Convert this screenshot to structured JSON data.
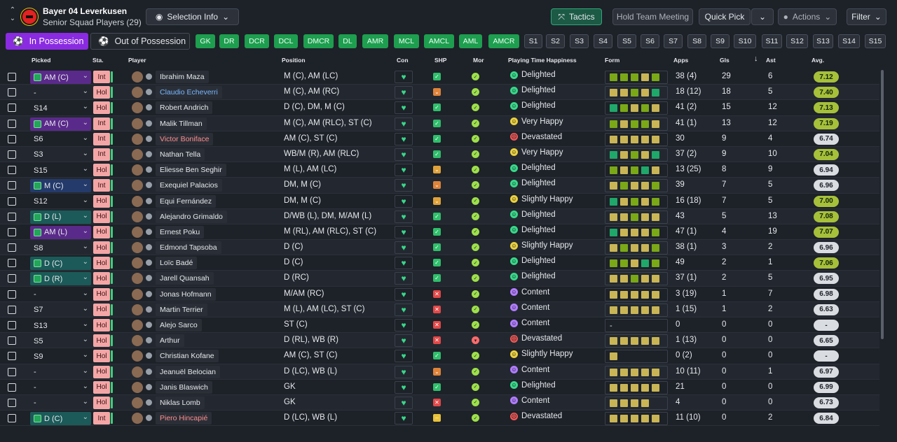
{
  "header": {
    "club": "Bayer 04 Leverkusen",
    "subtitle": "Senior Squad Players (29)",
    "selection_info": "Selection Info",
    "tactics": "Tactics",
    "hold_meeting": "Hold Team Meeting",
    "quick_pick": "Quick Pick",
    "actions": "Actions",
    "filter": "Filter"
  },
  "phase": {
    "in": "In Possession",
    "out": "Out of Possession"
  },
  "positions": [
    "GK",
    "DR",
    "DCR",
    "DCL",
    "DMCR",
    "DL",
    "AMR",
    "MCL",
    "AMCL",
    "AML",
    "AMCR"
  ],
  "sets": [
    "S1",
    "S2",
    "S3",
    "S4",
    "S5",
    "S6",
    "S7",
    "S8",
    "S9",
    "S10",
    "S11",
    "S12",
    "S13",
    "S14",
    "S15"
  ],
  "columns": {
    "picked": "Picked",
    "sta": "Sta.",
    "player": "Player",
    "position": "Position",
    "con": "Con",
    "shp": "SHP",
    "mor": "Mor",
    "pth": "Playing Time Happiness",
    "form": "Form",
    "apps": "Apps",
    "gls": "Gls",
    "ast": "Ast",
    "avg": "Avg."
  },
  "players": [
    {
      "picked": "AM (C)",
      "pk": "purple",
      "sta": "Int",
      "name": "Ibrahim Maza",
      "nc": "",
      "position": "M (C), AM (LC)",
      "shp": "ok",
      "mor": "ok",
      "happy": "Delighted",
      "hc": "#38d88a",
      "form": [
        "#7aa817",
        "#7aa817",
        "#7aa817",
        "#c9b555",
        "#7aa817"
      ],
      "apps": "38 (4)",
      "gls": "29",
      "ast": "6",
      "avg": "7.12",
      "ac": "hi"
    },
    {
      "picked": "-",
      "pk": "plain",
      "sta": "Hol",
      "name": "Claudio Echeverri",
      "nc": "blue",
      "position": "M (C), AM (RC)",
      "shp": "mid",
      "mor": "ok",
      "happy": "Delighted",
      "hc": "#38d88a",
      "form": [
        "#c9b555",
        "#c9b555",
        "#7aa817",
        "#c9b555",
        "#1fa86a"
      ],
      "apps": "18 (12)",
      "gls": "18",
      "ast": "5",
      "avg": "7.40",
      "ac": "hi"
    },
    {
      "picked": "S14",
      "pk": "plain",
      "sta": "Hol",
      "name": "Robert Andrich",
      "nc": "",
      "position": "D (C), DM, M (C)",
      "shp": "ok",
      "mor": "ok",
      "happy": "Delighted",
      "hc": "#38d88a",
      "form": [
        "#1fa86a",
        "#7aa817",
        "#c9b555",
        "#7aa817",
        "#c9b555"
      ],
      "apps": "41 (2)",
      "gls": "15",
      "ast": "12",
      "avg": "7.13",
      "ac": "hi"
    },
    {
      "picked": "AM (C)",
      "pk": "purple",
      "sta": "Int",
      "name": "Malik Tillman",
      "nc": "",
      "position": "M (C), AM (RLC), ST (C)",
      "shp": "ok",
      "mor": "ok",
      "happy": "Very Happy",
      "hc": "#e9d040",
      "form": [
        "#7aa817",
        "#c9b555",
        "#7aa817",
        "#7aa817",
        "#c9b555"
      ],
      "apps": "41 (1)",
      "gls": "13",
      "ast": "12",
      "avg": "7.19",
      "ac": "hi"
    },
    {
      "picked": "S6",
      "pk": "plain",
      "sta": "Int",
      "name": "Victor Boniface",
      "nc": "red",
      "position": "AM (C), ST (C)",
      "shp": "ok",
      "mor": "ok",
      "happy": "Devastated",
      "hc": "#f05a5a",
      "form": [
        "#c9b555",
        "#c9b555",
        "#c9b555",
        "#c9b555",
        "#c9b555"
      ],
      "apps": "30",
      "gls": "9",
      "ast": "4",
      "avg": "6.74",
      "ac": "md"
    },
    {
      "picked": "S3",
      "pk": "plain",
      "sta": "Int",
      "name": "Nathan Tella",
      "nc": "",
      "position": "WB/M (R), AM (RLC)",
      "shp": "ok",
      "mor": "ok",
      "happy": "Very Happy",
      "hc": "#e9d040",
      "form": [
        "#1fa86a",
        "#c9b555",
        "#7aa817",
        "#c9b555",
        "#1fa86a"
      ],
      "apps": "37 (2)",
      "gls": "9",
      "ast": "10",
      "avg": "7.04",
      "ac": "hi"
    },
    {
      "picked": "S15",
      "pk": "plain",
      "sta": "Hol",
      "name": "Eliesse Ben Seghir",
      "nc": "",
      "position": "M (L), AM (LC)",
      "shp": "mid2",
      "mor": "ok",
      "happy": "Delighted",
      "hc": "#38d88a",
      "form": [
        "#7aa817",
        "#c9b555",
        "#7aa817",
        "#1fa86a",
        "#c9b555"
      ],
      "apps": "13 (25)",
      "gls": "8",
      "ast": "9",
      "avg": "6.94",
      "ac": "md"
    },
    {
      "picked": "M (C)",
      "pk": "navy",
      "sta": "Int",
      "name": "Exequiel Palacios",
      "nc": "",
      "position": "DM, M (C)",
      "shp": "mid",
      "mor": "ok",
      "happy": "Delighted",
      "hc": "#38d88a",
      "form": [
        "#c9b555",
        "#7aa817",
        "#c9b555",
        "#c9b555",
        "#7aa817"
      ],
      "apps": "39",
      "gls": "7",
      "ast": "5",
      "avg": "6.96",
      "ac": "md"
    },
    {
      "picked": "S12",
      "pk": "plain",
      "sta": "Hol",
      "name": "Equi Fernández",
      "nc": "",
      "position": "DM, M (C)",
      "shp": "mid2",
      "mor": "ok",
      "happy": "Slightly Happy",
      "hc": "#e9d040",
      "form": [
        "#1fa86a",
        "#c9b555",
        "#7aa817",
        "#c9b555",
        "#7aa817"
      ],
      "apps": "16 (18)",
      "gls": "7",
      "ast": "5",
      "avg": "7.00",
      "ac": "hi"
    },
    {
      "picked": "D (L)",
      "pk": "teal",
      "sta": "Hol",
      "name": "Alejandro Grimaldo",
      "nc": "",
      "position": "D/WB (L), DM, M/AM (L)",
      "shp": "ok",
      "mor": "ok",
      "happy": "Delighted",
      "hc": "#38d88a",
      "form": [
        "#c9b555",
        "#c9b555",
        "#7aa817",
        "#c9b555",
        "#c9b555"
      ],
      "apps": "43",
      "gls": "5",
      "ast": "13",
      "avg": "7.08",
      "ac": "hi"
    },
    {
      "picked": "AM (L)",
      "pk": "purple",
      "sta": "Hol",
      "name": "Ernest Poku",
      "nc": "",
      "position": "M (RL), AM (RLC), ST (C)",
      "shp": "ok",
      "mor": "ok",
      "happy": "Delighted",
      "hc": "#38d88a",
      "form": [
        "#1fa86a",
        "#c9b555",
        "#c9b555",
        "#c9b555",
        "#7aa817"
      ],
      "apps": "47 (1)",
      "gls": "4",
      "ast": "19",
      "avg": "7.07",
      "ac": "hi"
    },
    {
      "picked": "S8",
      "pk": "plain",
      "sta": "Hol",
      "name": "Edmond Tapsoba",
      "nc": "",
      "position": "D (C)",
      "shp": "ok",
      "mor": "ok",
      "happy": "Slightly Happy",
      "hc": "#e9d040",
      "form": [
        "#c9b555",
        "#7aa817",
        "#c9b555",
        "#c9b555",
        "#7aa817"
      ],
      "apps": "38 (1)",
      "gls": "3",
      "ast": "2",
      "avg": "6.96",
      "ac": "md"
    },
    {
      "picked": "D (C)",
      "pk": "teal",
      "sta": "Hol",
      "name": "Loïc Badé",
      "nc": "",
      "position": "D (C)",
      "shp": "ok",
      "mor": "ok",
      "happy": "Delighted",
      "hc": "#38d88a",
      "form": [
        "#7aa817",
        "#7aa817",
        "#c9b555",
        "#1fa86a",
        "#7aa817"
      ],
      "apps": "49",
      "gls": "2",
      "ast": "1",
      "avg": "7.06",
      "ac": "hi"
    },
    {
      "picked": "D (R)",
      "pk": "teal",
      "sta": "Hol",
      "name": "Jarell Quansah",
      "nc": "",
      "position": "D (RC)",
      "shp": "ok",
      "mor": "ok",
      "happy": "Delighted",
      "hc": "#38d88a",
      "form": [
        "#c9b555",
        "#c9b555",
        "#7aa817",
        "#c9b555",
        "#c9b555"
      ],
      "apps": "37 (1)",
      "gls": "2",
      "ast": "5",
      "avg": "6.95",
      "ac": "md"
    },
    {
      "picked": "-",
      "pk": "plain",
      "sta": "Hol",
      "name": "Jonas Hofmann",
      "nc": "",
      "position": "M/AM (RC)",
      "shp": "bad",
      "mor": "ok",
      "happy": "Content",
      "hc": "#b07cff",
      "form": [
        "#c9b555",
        "#c9b555",
        "#c9b555",
        "#c9b555",
        "#c9b555"
      ],
      "apps": "3 (19)",
      "gls": "1",
      "ast": "7",
      "avg": "6.98",
      "ac": "md"
    },
    {
      "picked": "S7",
      "pk": "plain",
      "sta": "Hol",
      "name": "Martin Terrier",
      "nc": "",
      "position": "M (L), AM (LC), ST (C)",
      "shp": "bad",
      "mor": "ok",
      "happy": "Content",
      "hc": "#b07cff",
      "form": [
        "#c9b555",
        "#c9b555",
        "#c9b555",
        "#c9b555",
        "#c9b555"
      ],
      "apps": "1 (15)",
      "gls": "1",
      "ast": "2",
      "avg": "6.63",
      "ac": "md"
    },
    {
      "picked": "S13",
      "pk": "plain",
      "sta": "Hol",
      "name": "Alejo Sarco",
      "nc": "",
      "position": "ST (C)",
      "shp": "bad",
      "mor": "ok",
      "happy": "Content",
      "hc": "#b07cff",
      "form": [],
      "formtext": "-",
      "apps": "0",
      "gls": "0",
      "ast": "0",
      "avg": "-",
      "ac": "md"
    },
    {
      "picked": "S5",
      "pk": "plain",
      "sta": "Hol",
      "name": "Arthur",
      "nc": "",
      "position": "D (RL), WB (R)",
      "shp": "bad",
      "mor": "bad",
      "happy": "Devastated",
      "hc": "#f05a5a",
      "form": [
        "#c9b555",
        "#c9b555",
        "#c9b555",
        "#c9b555",
        "#c9b555"
      ],
      "apps": "1 (13)",
      "gls": "0",
      "ast": "0",
      "avg": "6.65",
      "ac": "md"
    },
    {
      "picked": "S9",
      "pk": "plain",
      "sta": "Hol",
      "name": "Christian Kofane",
      "nc": "",
      "position": "AM (C), ST (C)",
      "shp": "ok",
      "mor": "ok",
      "happy": "Slightly Happy",
      "hc": "#e9d040",
      "form": [
        "#c9b555"
      ],
      "apps": "0 (2)",
      "gls": "0",
      "ast": "0",
      "avg": "-",
      "ac": "md"
    },
    {
      "picked": "-",
      "pk": "plain",
      "sta": "Hol",
      "name": "Jeanuël Belocian",
      "nc": "",
      "position": "D (LC), WB (L)",
      "shp": "mid",
      "mor": "ok",
      "happy": "Content",
      "hc": "#b07cff",
      "form": [
        "#c9b555",
        "#c9b555",
        "#c9b555",
        "#c9b555",
        "#c9b555"
      ],
      "apps": "10 (11)",
      "gls": "0",
      "ast": "1",
      "avg": "6.97",
      "ac": "md"
    },
    {
      "picked": "-",
      "pk": "plain",
      "sta": "Hol",
      "name": "Janis Blaswich",
      "nc": "",
      "position": "GK",
      "shp": "ok",
      "mor": "ok",
      "happy": "Delighted",
      "hc": "#38d88a",
      "form": [
        "#c9b555",
        "#c9b555",
        "#c9b555",
        "#c9b555",
        "#c9b555"
      ],
      "apps": "21",
      "gls": "0",
      "ast": "0",
      "avg": "6.99",
      "ac": "md"
    },
    {
      "picked": "-",
      "pk": "plain",
      "sta": "Hol",
      "name": "Niklas Lomb",
      "nc": "",
      "position": "GK",
      "shp": "bad",
      "mor": "ok",
      "happy": "Content",
      "hc": "#b07cff",
      "form": [
        "#c9b555",
        "#c9b555",
        "#c9b555",
        "#c9b555"
      ],
      "apps": "4",
      "gls": "0",
      "ast": "0",
      "avg": "6.73",
      "ac": "md"
    },
    {
      "picked": "D (C)",
      "pk": "teal",
      "sta": "Int",
      "name": "Piero Hincapié",
      "nc": "red",
      "position": "D (LC), WB (L)",
      "shp": "warn",
      "mor": "ok",
      "happy": "Devastated",
      "hc": "#f05a5a",
      "form": [
        "#c9b555",
        "#c9b555",
        "#c9b555",
        "#c9b555",
        "#c9b555"
      ],
      "apps": "11 (10)",
      "gls": "0",
      "ast": "2",
      "avg": "6.84",
      "ac": "md"
    }
  ]
}
